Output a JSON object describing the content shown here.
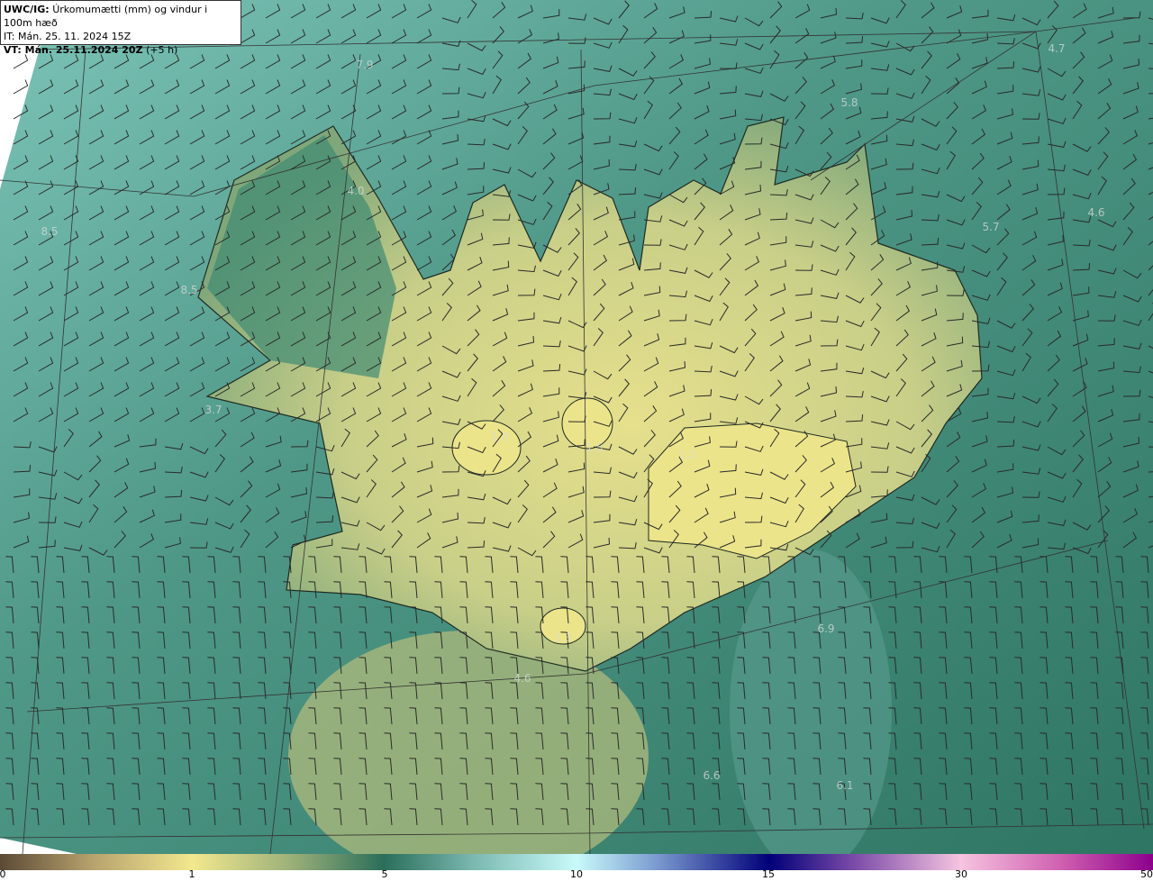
{
  "header": {
    "model_label": "UWC/IG:",
    "product": "Úrkomumætti (mm) og vindur i 100m hæð",
    "init_time": "IT: Mán. 25. 11. 2024 15Z",
    "valid_label": "VT: Mán. 25.11.2024 20Z",
    "lead": "(+5 h)"
  },
  "map_values": [
    "7.9",
    "5.8",
    "4.7",
    "4.0",
    "8.5",
    "8.5",
    "3.7",
    "4.6",
    "5.7",
    "1.8",
    "1.5",
    "1.2",
    "1.3",
    "6.9",
    "4.6",
    "6.6",
    "6.1"
  ],
  "colorbar": {
    "ticks": [
      "0",
      "1",
      "5",
      "10",
      "15",
      "30",
      "50"
    ],
    "colors": [
      "#5c4a36",
      "#f2e88e",
      "#2a6e5a",
      "#c8fafa",
      "#000078",
      "#f6c4e0",
      "#8c008c"
    ]
  }
}
